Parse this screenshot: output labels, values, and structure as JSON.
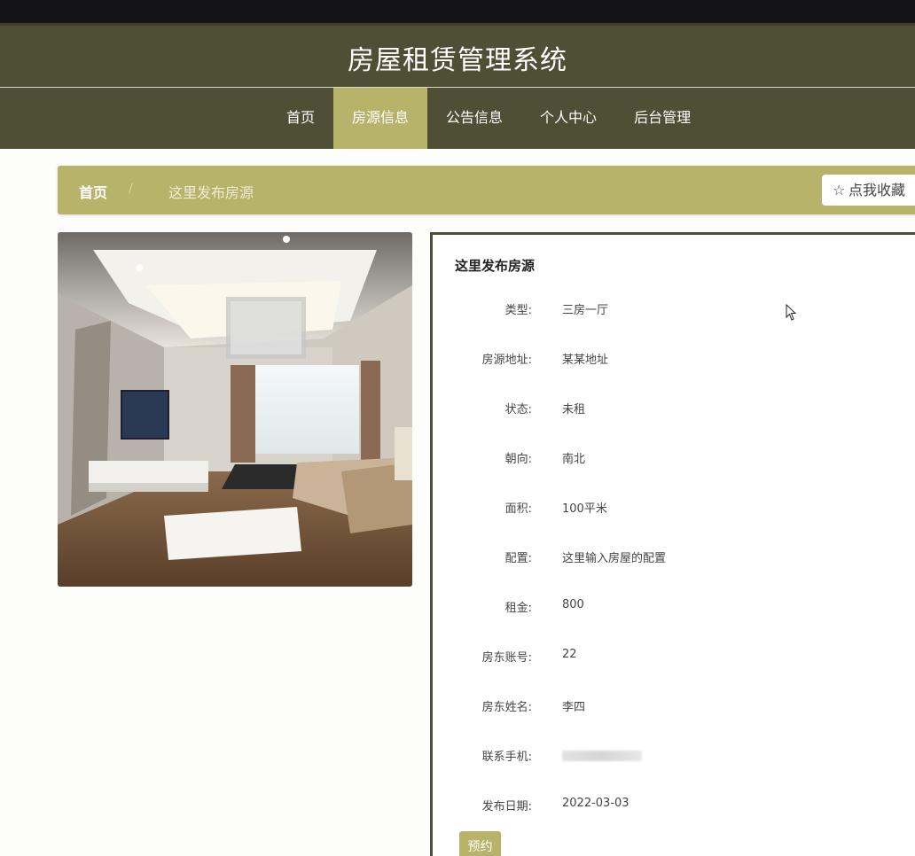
{
  "header": {
    "title": "房屋租赁管理系统"
  },
  "nav": {
    "items": [
      {
        "label": "首页"
      },
      {
        "label": "房源信息",
        "active": true
      },
      {
        "label": "公告信息"
      },
      {
        "label": "个人中心"
      },
      {
        "label": "后台管理"
      }
    ]
  },
  "breadcrumb": {
    "home": "首页",
    "separator": "/",
    "current": "这里发布房源",
    "favorite_star": "☆",
    "favorite_label": "点我收藏"
  },
  "detail": {
    "title": "这里发布房源",
    "fields": [
      {
        "label": "类型:",
        "value": "三房一厅"
      },
      {
        "label": "房源地址:",
        "value": "某某地址"
      },
      {
        "label": "状态:",
        "value": "未租"
      },
      {
        "label": "朝向:",
        "value": "南北"
      },
      {
        "label": "面积:",
        "value": "100平米"
      },
      {
        "label": "配置:",
        "value": "这里输入房屋的配置"
      },
      {
        "label": "租金:",
        "value": "800"
      },
      {
        "label": "房东账号:",
        "value": "22"
      },
      {
        "label": "房东姓名:",
        "value": "李四"
      },
      {
        "label": "联系手机:",
        "value": ""
      },
      {
        "label": "发布日期:",
        "value": "2022-03-03"
      }
    ],
    "book_button": "预约"
  },
  "colors": {
    "header_bg": "#4e4f35",
    "accent": "#b8b36a",
    "topbar": "#141416"
  }
}
